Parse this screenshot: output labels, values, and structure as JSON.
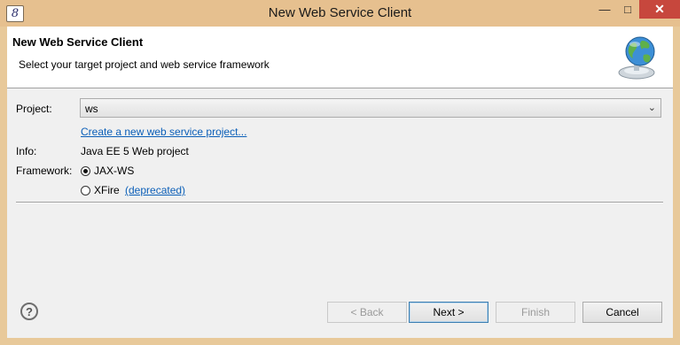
{
  "window": {
    "title": "New Web Service Client",
    "app_icon_glyph": "8"
  },
  "title_buttons": {
    "minimize": "—",
    "maximize": "□",
    "close": "✕"
  },
  "header": {
    "title": "New Web Service Client",
    "description": "Select your target project and web service framework"
  },
  "form": {
    "project_label": "Project:",
    "project_value": "ws",
    "create_link": "Create a new web service project...",
    "info_label": "Info:",
    "info_value": "Java EE 5 Web project",
    "framework_label": "Framework:",
    "frameworks": [
      {
        "label": "JAX-WS",
        "selected": true
      },
      {
        "label": "XFire",
        "selected": false,
        "note": "(deprecated)"
      }
    ]
  },
  "buttons": {
    "help": "?",
    "back": "< Back",
    "next": "Next >",
    "finish": "Finish",
    "cancel": "Cancel"
  },
  "colors": {
    "titlebar": "#e6c08f",
    "close_button": "#c7473d",
    "link": "#0b5fb8"
  }
}
